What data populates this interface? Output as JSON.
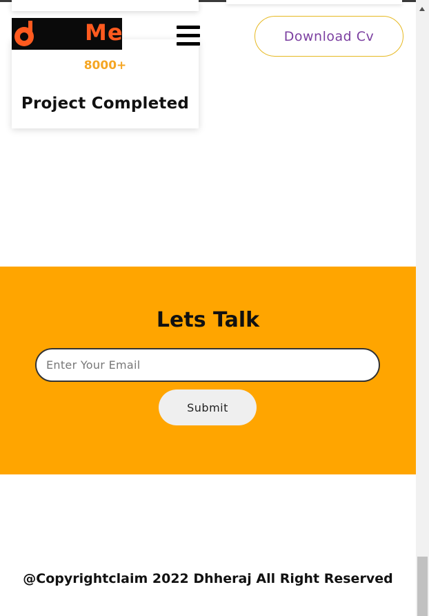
{
  "header": {
    "logo_text": "Me",
    "cv_button_label": "Download Cv"
  },
  "stats": {
    "number": "8000+",
    "label": "Project Completed"
  },
  "contact": {
    "title": "Lets Talk",
    "email_placeholder": "Enter Your Email",
    "email_value": "",
    "submit_label": "Submit"
  },
  "footer": {
    "copyright": "@Copyrightclaim 2022 Dhheraj All Right Reserved"
  },
  "colors": {
    "accent_orange": "#ffa500",
    "stat_number": "#f5a623",
    "logo_orange": "#ff5a1f",
    "cv_text": "#7b3fa0",
    "cv_border": "#e6b820"
  },
  "icons": {
    "menu": "hamburger-icon",
    "logo": "logo-mark-icon",
    "scroll_up": "scroll-up-arrow-icon"
  }
}
